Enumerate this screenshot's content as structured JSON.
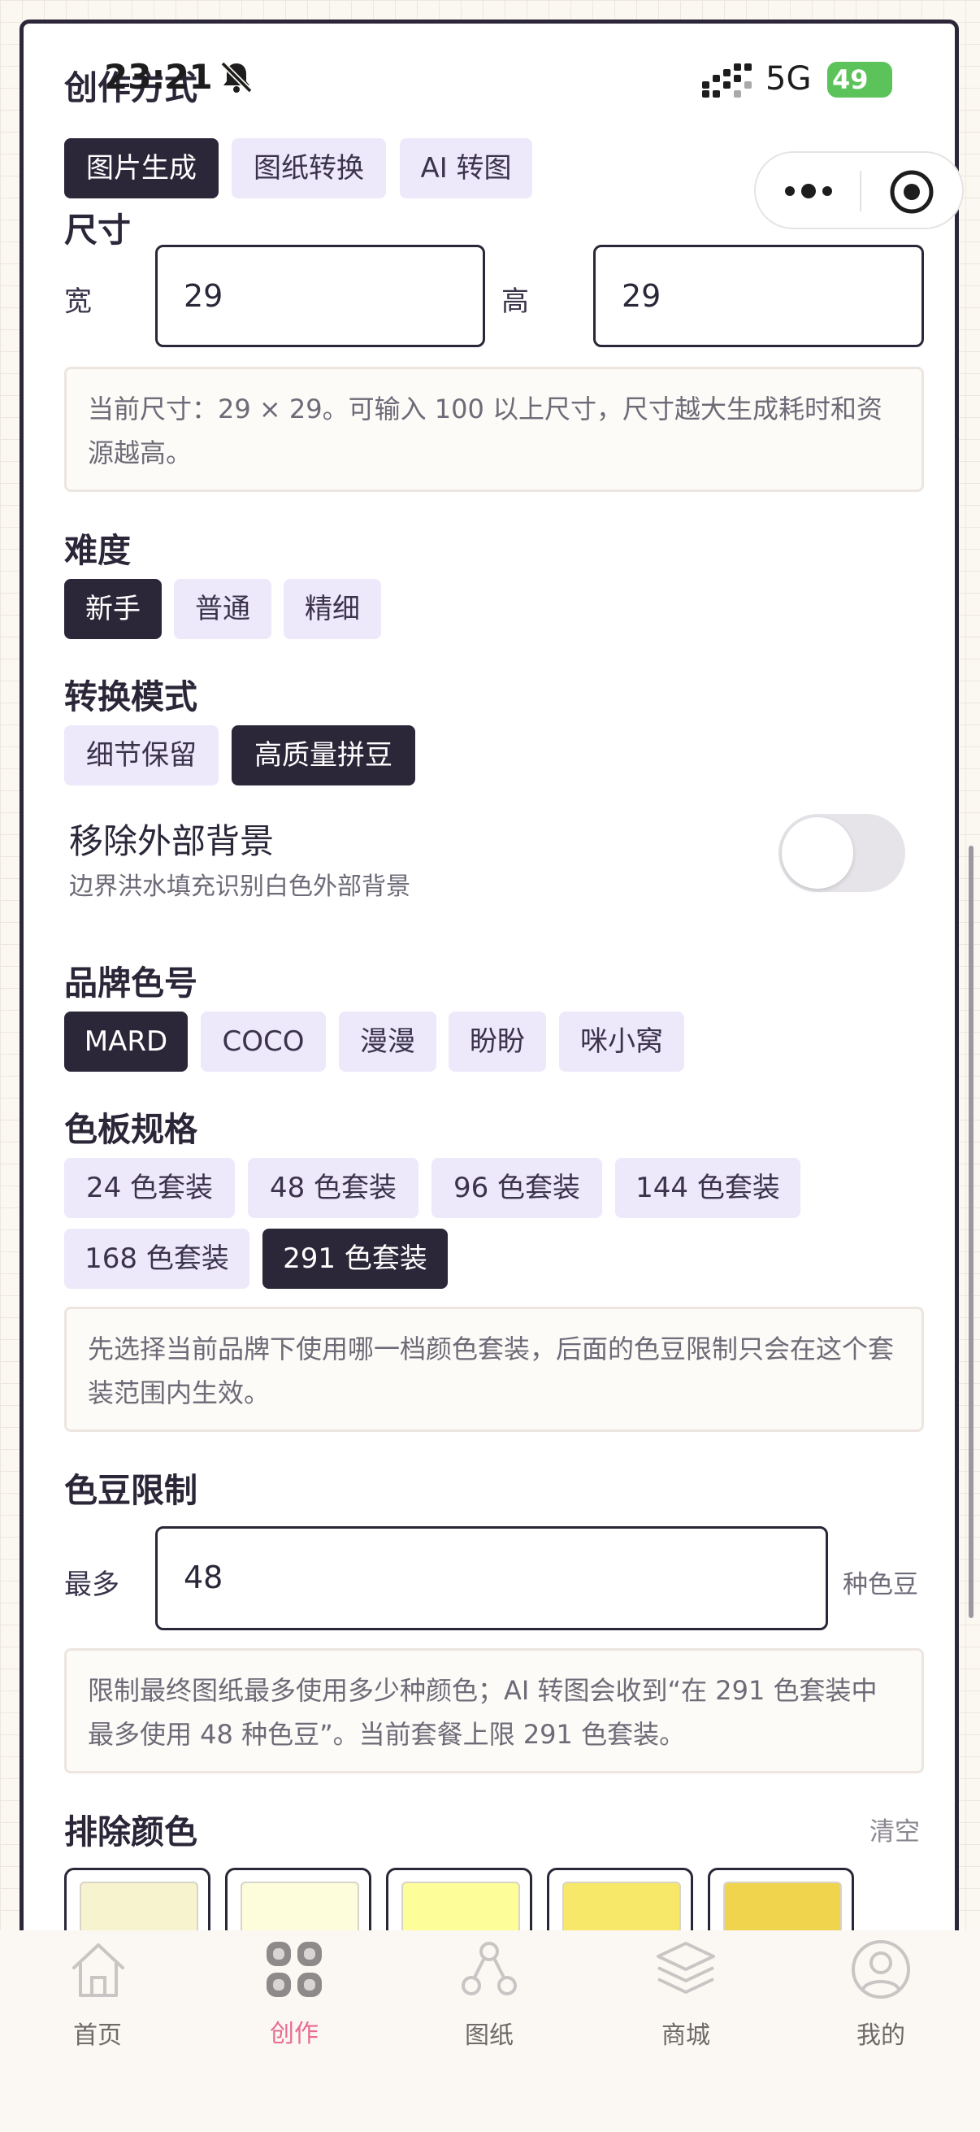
{
  "status_bar": {
    "time": "23:21",
    "network": "5G",
    "battery": "49"
  },
  "mode": {
    "title": "创作方式",
    "options": [
      "图片生成",
      "图纸转换",
      "AI 转图"
    ],
    "selected": 0
  },
  "size": {
    "title": "尺寸",
    "width_label": "宽",
    "width_value": "29",
    "height_label": "高",
    "height_value": "29",
    "note": "当前尺寸：29 × 29。可输入 100 以上尺寸，尺寸越大生成耗时和资源越高。"
  },
  "difficulty": {
    "title": "难度",
    "options": [
      "新手",
      "普通",
      "精细"
    ],
    "selected": 0
  },
  "convert_mode": {
    "title": "转换模式",
    "options": [
      "细节保留",
      "高质量拼豆"
    ],
    "selected": 1
  },
  "remove_bg": {
    "title": "移除外部背景",
    "subtitle": "边界洪水填充识别白色外部背景",
    "enabled": false
  },
  "brand": {
    "title": "品牌色号",
    "options": [
      "MARD",
      "COCO",
      "漫漫",
      "盼盼",
      "咪小窝"
    ],
    "selected": 0
  },
  "palette": {
    "title": "色板规格",
    "options": [
      "24 色套装",
      "48 色套装",
      "96 色套装",
      "144 色套装",
      "168 色套装",
      "291 色套装"
    ],
    "selected": 5,
    "note": "先选择当前品牌下使用哪一档颜色套装，后面的色豆限制只会在这个套装范围内生效。"
  },
  "bead_limit": {
    "title": "色豆限制",
    "prefix": "最多",
    "value": "48",
    "suffix": "种色豆",
    "note": "限制最终图纸最多使用多少种颜色；AI 转图会收到“在 291 色套装中最多使用 48 种色豆”。当前套餐上限 291 色套装。"
  },
  "exclude": {
    "title": "排除颜色",
    "clear_label": "清空",
    "swatches": [
      "#f7f3cf",
      "#fdfddc",
      "#fdfd9a",
      "#f8e86a",
      "#f0d44e"
    ]
  },
  "tabs": [
    {
      "label": "首页",
      "icon": "home-icon"
    },
    {
      "label": "创作",
      "icon": "create-icon",
      "active": true
    },
    {
      "label": "图纸",
      "icon": "pattern-icon"
    },
    {
      "label": "商城",
      "icon": "shop-icon"
    },
    {
      "label": "我的",
      "icon": "profile-icon"
    }
  ],
  "colors": {
    "accent": "#2b2638",
    "chip": "#eee8fb",
    "active_tab": "#e86b94",
    "battery": "#5cc35a"
  }
}
